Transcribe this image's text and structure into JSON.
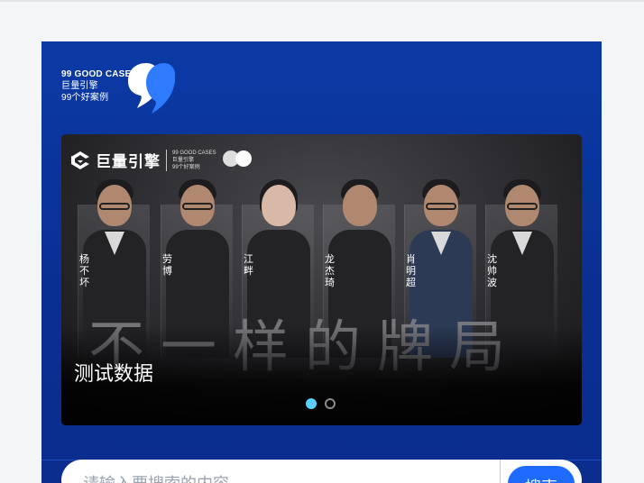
{
  "logo": {
    "line1": "99 GOOD CASES",
    "line2": "巨量引擎",
    "line3": "99个好案例"
  },
  "banner": {
    "brand_name": "巨量引擎",
    "brand_mini_lines": [
      "99 GOOD CASES",
      "巨量引擎",
      "99个好案例"
    ],
    "people": [
      {
        "name": "杨不坏"
      },
      {
        "name": "劳博"
      },
      {
        "name": "江畔"
      },
      {
        "name": "龙杰琦"
      },
      {
        "name": "肖明超"
      },
      {
        "name": "沈帅波"
      }
    ],
    "slogan": "不一样的牌局",
    "caption": "测试数据",
    "pagination": {
      "current": 1,
      "total": 2
    }
  },
  "search": {
    "placeholder": "请输入要搜索的内容",
    "button_label": "搜索"
  },
  "colors": {
    "card_bg": "#0b3aa5",
    "accent": "#1f6bff",
    "dot_active": "#5bd0ff"
  }
}
